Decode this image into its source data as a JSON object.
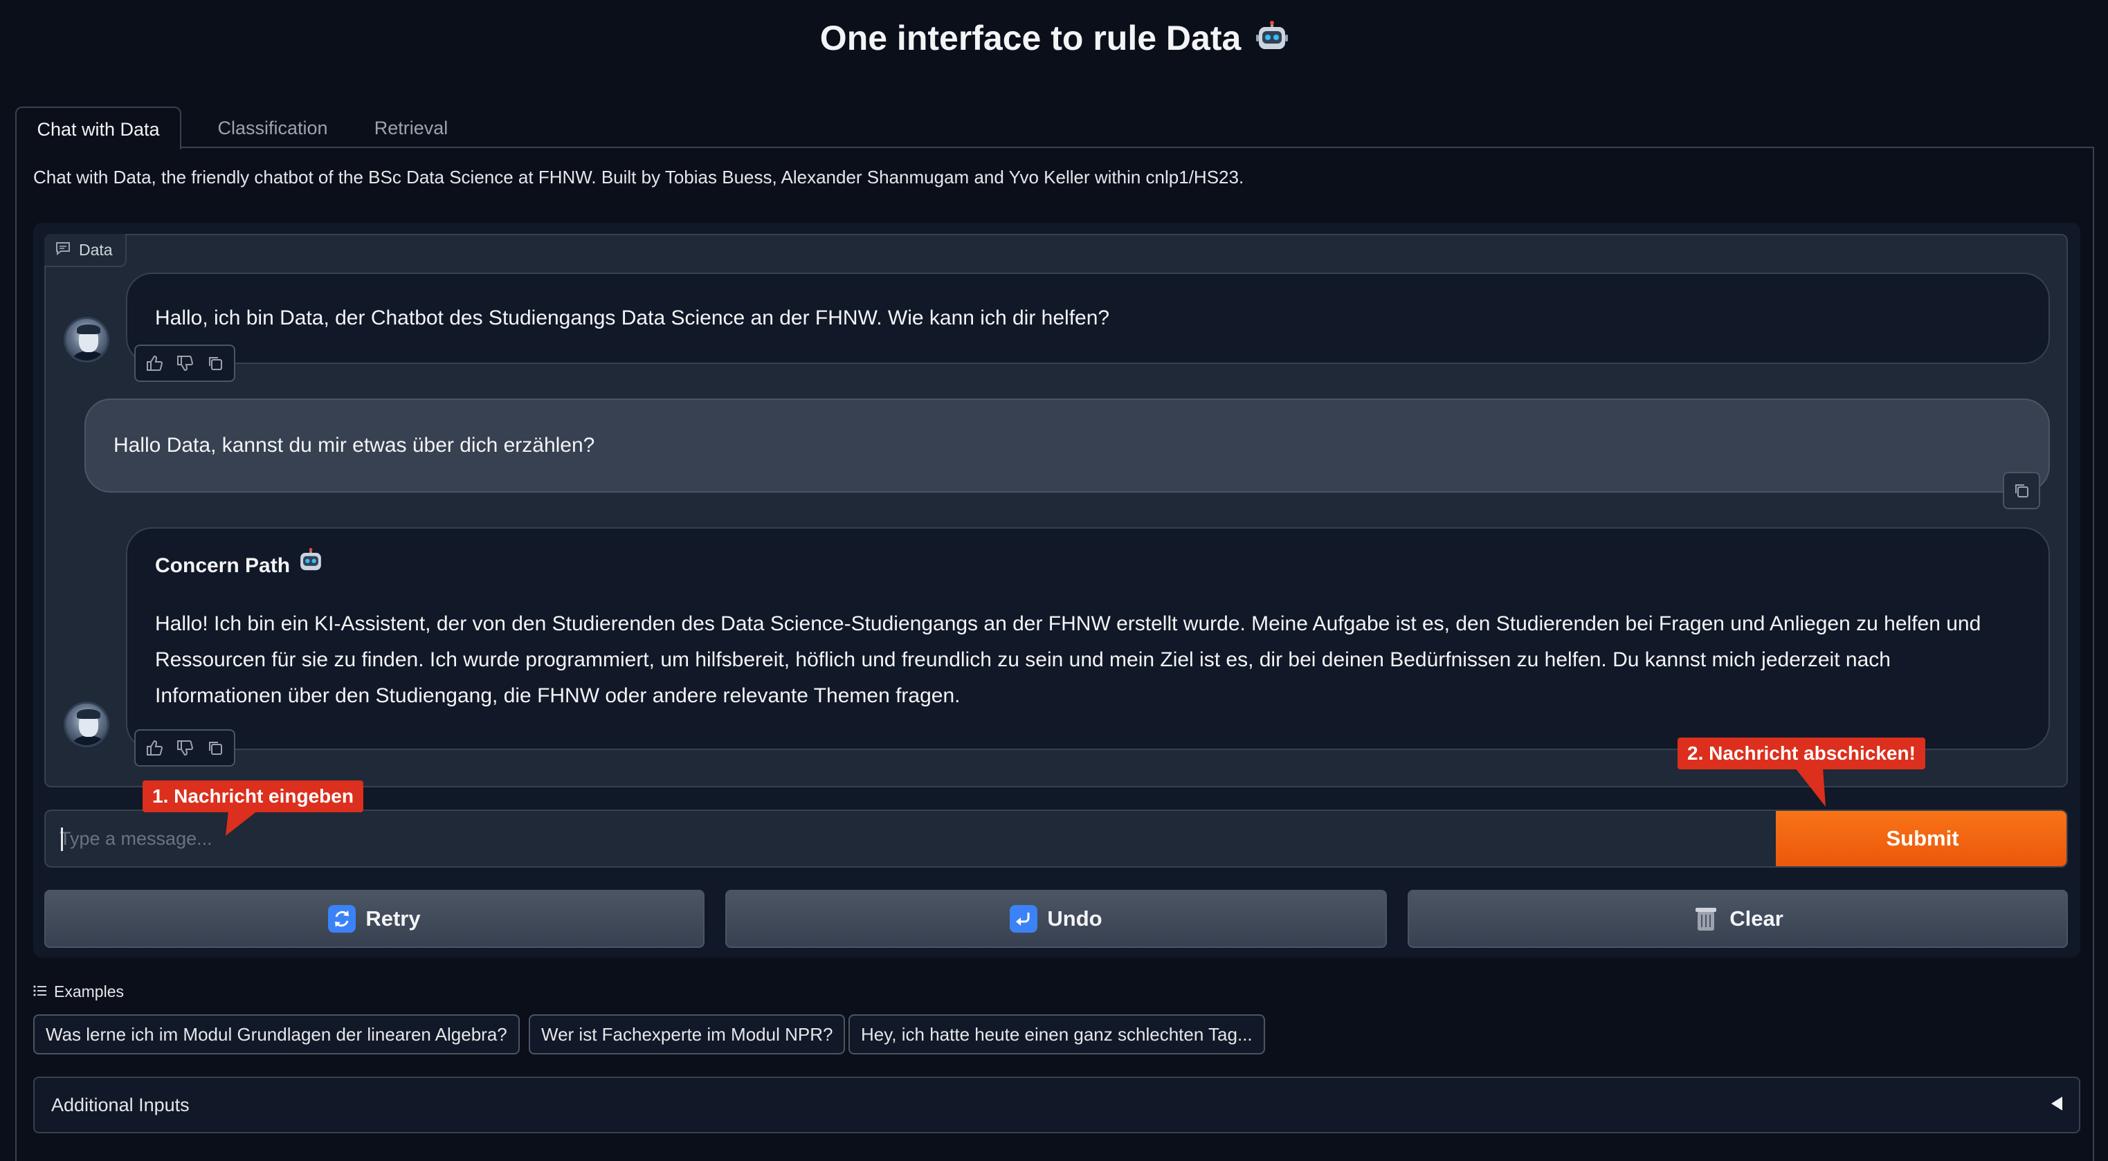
{
  "header": {
    "title": "One interface to rule Data"
  },
  "tabs": [
    {
      "label": "Chat with Data",
      "active": true
    },
    {
      "label": "Classification",
      "active": false
    },
    {
      "label": "Retrieval",
      "active": false
    }
  ],
  "description": "Chat with Data, the friendly chatbot of the BSc Data Science at FHNW. Built by Tobias Buess, Alexander Shanmugam and Yvo Keller within cnlp1/HS23.",
  "chatbot": {
    "label": "Data",
    "messages": [
      {
        "role": "bot",
        "text": "Hallo, ich bin Data, der Chatbot des Studiengangs Data Science an der FHNW. Wie kann ich dir helfen?"
      },
      {
        "role": "user",
        "text": "Hallo Data, kannst du mir etwas über dich erzählen?"
      },
      {
        "role": "bot",
        "title": "Concern Path",
        "lines": [
          "Hallo! Ich bin ein KI-Assistent, der von den Studierenden des Data Science-Studiengangs an der FHNW erstellt wurde. Meine Aufgabe ist es, den Studierenden bei Fragen und Anliegen zu helfen und",
          "Ressourcen für sie zu finden. Ich wurde programmiert, um hilfsbereit, höflich und freundlich zu sein und mein Ziel ist es, dir bei deinen Bedürfnissen zu helfen. Du kannst mich jederzeit nach",
          "Informationen über den Studiengang, die FHNW oder andere relevante Themen fragen."
        ]
      }
    ]
  },
  "input": {
    "placeholder": "Type a message...",
    "value": ""
  },
  "submit_label": "Submit",
  "tooltips": {
    "input": "1. Nachricht eingeben",
    "submit": "2. Nachricht abschicken!"
  },
  "actions": {
    "retry": "Retry",
    "undo": "Undo",
    "clear": "Clear"
  },
  "examples": {
    "label": "Examples",
    "items": [
      "Was lerne ich im Modul Grundlagen der linearen Algebra?",
      "Wer ist Fachexperte im Modul NPR?",
      "Hey, ich hatte heute einen ganz schlechten Tag..."
    ]
  },
  "accordion": {
    "label": "Additional Inputs"
  },
  "colors": {
    "accent": "#f97316",
    "tooltip": "#dc2f1d",
    "background": "#0b0f19"
  }
}
